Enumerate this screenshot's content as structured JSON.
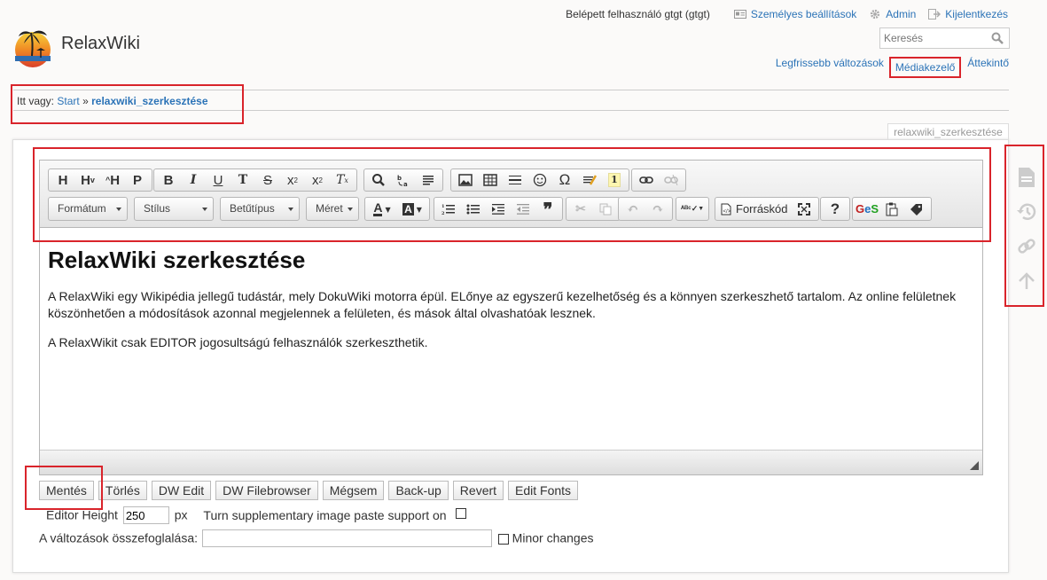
{
  "site": {
    "title": "RelaxWiki"
  },
  "user": {
    "logged_in_text": "Belépett felhasználó gtgt (gtgt)",
    "settings_label": "Személyes beállítások",
    "admin_label": "Admin",
    "logout_label": "Kijelentkezés"
  },
  "search": {
    "placeholder": "Keresés"
  },
  "nav": {
    "recent_label": "Legfrissebb változások",
    "media_label": "Médiakezelő",
    "index_label": "Áttekintő"
  },
  "breadcrumb": {
    "prefix": "Itt vagy:",
    "start": "Start",
    "sep": "»",
    "current": "relaxwiki_szerkesztése"
  },
  "page_id": "relaxwiki_szerkesztése",
  "toolbar": {
    "combos": [
      "Formátum",
      "Stílus",
      "Betűtípus",
      "Méret"
    ],
    "source_label": "Forráskód"
  },
  "content": {
    "heading": "RelaxWiki szerkesztése",
    "p1": "A RelaxWiki egy Wikipédia jellegű tudástár, mely DokuWiki motorra épül. ELőnye az egyszerű kezelhetőség és a könnyen szerkeszhető tartalom. Az online felületnek köszönhetően a módosítások azonnal megjelennek a felületen, és mások által olvashatóak lesznek.",
    "p2": "A RelaxWikit csak EDITOR jogosultságú felhasználók szerkeszthetik."
  },
  "buttons": [
    "Mentés",
    "Törlés",
    "DW Edit",
    "DW Filebrowser",
    "Mégsem",
    "Back-up",
    "Revert",
    "Edit Fonts"
  ],
  "options": {
    "height_label": "Editor Height",
    "height_value": "250",
    "height_unit": "px",
    "paste_label": "Turn supplementary image paste support on",
    "summary_label": "A változások összefoglalása:",
    "minor_label": "Minor changes"
  },
  "colors": {
    "link": "#2b73b7",
    "highlight": "#d9242b"
  }
}
